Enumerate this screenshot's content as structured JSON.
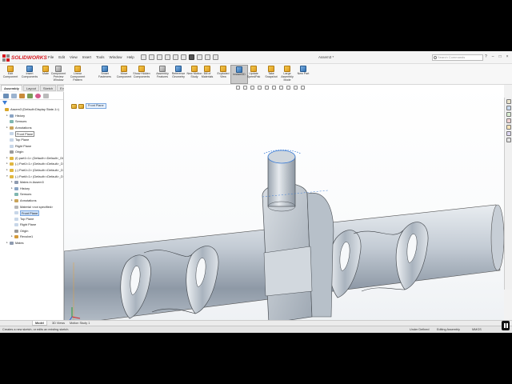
{
  "app": {
    "brand": "SOLIDWORKS",
    "document_title": "Assem3 *",
    "search_placeholder": "Search Commands",
    "window_controls": [
      "?",
      "–",
      "□",
      "×"
    ]
  },
  "menus": [
    "File",
    "Edit",
    "View",
    "Insert",
    "Tools",
    "Window",
    "Help"
  ],
  "commands": [
    {
      "label": "Edit Component",
      "icon": "edit-component-icon",
      "state": "normal"
    },
    {
      "label": "Insert Components",
      "icon": "insert-components-icon",
      "state": "normal"
    },
    {
      "label": "Mate",
      "icon": "mate-icon",
      "state": "normal"
    },
    {
      "label": "Component Preview Window",
      "icon": "preview-window-icon",
      "state": "normal"
    },
    {
      "label": "Linear Component Pattern",
      "icon": "linear-pattern-icon",
      "state": "normal"
    },
    {
      "label": "Smart Fasteners",
      "icon": "smart-fasteners-icon",
      "state": "normal"
    },
    {
      "label": "Move Component",
      "icon": "move-component-icon",
      "state": "normal"
    },
    {
      "label": "Show Hidden Components",
      "icon": "show-hidden-icon",
      "state": "normal"
    },
    {
      "label": "Assembly Features",
      "icon": "assembly-features-icon",
      "state": "normal"
    },
    {
      "label": "Reference Geometry",
      "icon": "reference-geometry-icon",
      "state": "normal"
    },
    {
      "label": "New Motion Study",
      "icon": "motion-study-icon",
      "state": "normal"
    },
    {
      "label": "Bill of Materials",
      "icon": "bom-icon",
      "state": "normal"
    },
    {
      "label": "Exploded View",
      "icon": "exploded-view-icon",
      "state": "normal"
    },
    {
      "label": "Instant3D",
      "icon": "instant3d-icon",
      "state": "active"
    },
    {
      "label": "Update SpeedPak",
      "icon": "speedpak-icon",
      "state": "normal"
    },
    {
      "label": "Take Snapshot",
      "icon": "snapshot-icon",
      "state": "normal"
    },
    {
      "label": "Large Assembly Mode",
      "icon": "large-assembly-icon",
      "state": "normal"
    },
    {
      "label": "New Part",
      "icon": "new-part-icon",
      "state": "normal"
    }
  ],
  "command_tabs": [
    "Assembly",
    "Layout",
    "Sketch",
    "Evaluate",
    "SOLIDWORKS Add-Ins",
    "SOLIDWORKS MBD"
  ],
  "feature_tree": [
    {
      "label": "Assem3 (Default<Display State-1>)",
      "depth": 0,
      "expander": "",
      "icon": "assembly-icon",
      "style": "normal"
    },
    {
      "label": "History",
      "depth": 1,
      "expander": "▸",
      "icon": "history-icon",
      "style": "normal"
    },
    {
      "label": "Sensors",
      "depth": 1,
      "expander": "",
      "icon": "sensors-icon",
      "style": "normal"
    },
    {
      "label": "Annotations",
      "depth": 1,
      "expander": "▸",
      "icon": "annotations-icon",
      "style": "normal"
    },
    {
      "label": "Front Plane",
      "depth": 1,
      "expander": "",
      "icon": "plane-icon",
      "style": "boxed"
    },
    {
      "label": "Top Plane",
      "depth": 1,
      "expander": "",
      "icon": "plane-icon",
      "style": "normal"
    },
    {
      "label": "Right Plane",
      "depth": 1,
      "expander": "",
      "icon": "plane-icon",
      "style": "normal"
    },
    {
      "label": "Origin",
      "depth": 1,
      "expander": "",
      "icon": "origin-icon",
      "style": "normal"
    },
    {
      "label": "(f) part1<1> (Default<<Default>_Di",
      "depth": 1,
      "expander": "▸",
      "icon": "part-icon",
      "style": "normal"
    },
    {
      "label": "(-) Part1<1> (Default<<Default>_D",
      "depth": 1,
      "expander": "▸",
      "icon": "part-icon",
      "style": "normal"
    },
    {
      "label": "(-) Part1<2> (Default<<Default>_D",
      "depth": 1,
      "expander": "▸",
      "icon": "part-icon",
      "style": "normal"
    },
    {
      "label": "(-) Part4<1> (Default<<Default>_D",
      "depth": 1,
      "expander": "▾",
      "icon": "part-icon",
      "style": "normal"
    },
    {
      "label": "Mates in Assem3",
      "depth": 2,
      "expander": "▸",
      "icon": "mates-icon",
      "style": "normal"
    },
    {
      "label": "History",
      "depth": 2,
      "expander": "▸",
      "icon": "history-icon",
      "style": "normal"
    },
    {
      "label": "Sensors",
      "depth": 2,
      "expander": "",
      "icon": "sensors-icon",
      "style": "normal"
    },
    {
      "label": "Annotations",
      "depth": 2,
      "expander": "▸",
      "icon": "annotations-icon",
      "style": "normal"
    },
    {
      "label": "Material <not specified>",
      "depth": 2,
      "expander": "",
      "icon": "material-icon",
      "style": "normal"
    },
    {
      "label": "Front Plane",
      "depth": 2,
      "expander": "",
      "icon": "plane-icon",
      "style": "selected"
    },
    {
      "label": "Top Plane",
      "depth": 2,
      "expander": "",
      "icon": "plane-icon",
      "style": "normal"
    },
    {
      "label": "Right Plane",
      "depth": 2,
      "expander": "",
      "icon": "plane-icon",
      "style": "normal"
    },
    {
      "label": "Origin",
      "depth": 2,
      "expander": "",
      "icon": "origin-icon",
      "style": "normal"
    },
    {
      "label": "Revolve1",
      "depth": 2,
      "expander": "▸",
      "icon": "revolve-icon",
      "style": "normal"
    },
    {
      "label": "Mates",
      "depth": 1,
      "expander": "▸",
      "icon": "mates-icon",
      "style": "normal"
    }
  ],
  "breadcrumb": {
    "label": "Front Plane"
  },
  "bottom_tabs": [
    "Model",
    "3D Views",
    "Motion Study 1"
  ],
  "status": {
    "message": "Creates a new sketch, or edits an existing sketch.",
    "definition": "Under Defined",
    "mode": "Editing Assembly",
    "units": "MMGS"
  },
  "colors": {
    "brand_red": "#d71920",
    "selection_blue": "#3a7bd5",
    "model_steel": "#b9c2cc"
  }
}
